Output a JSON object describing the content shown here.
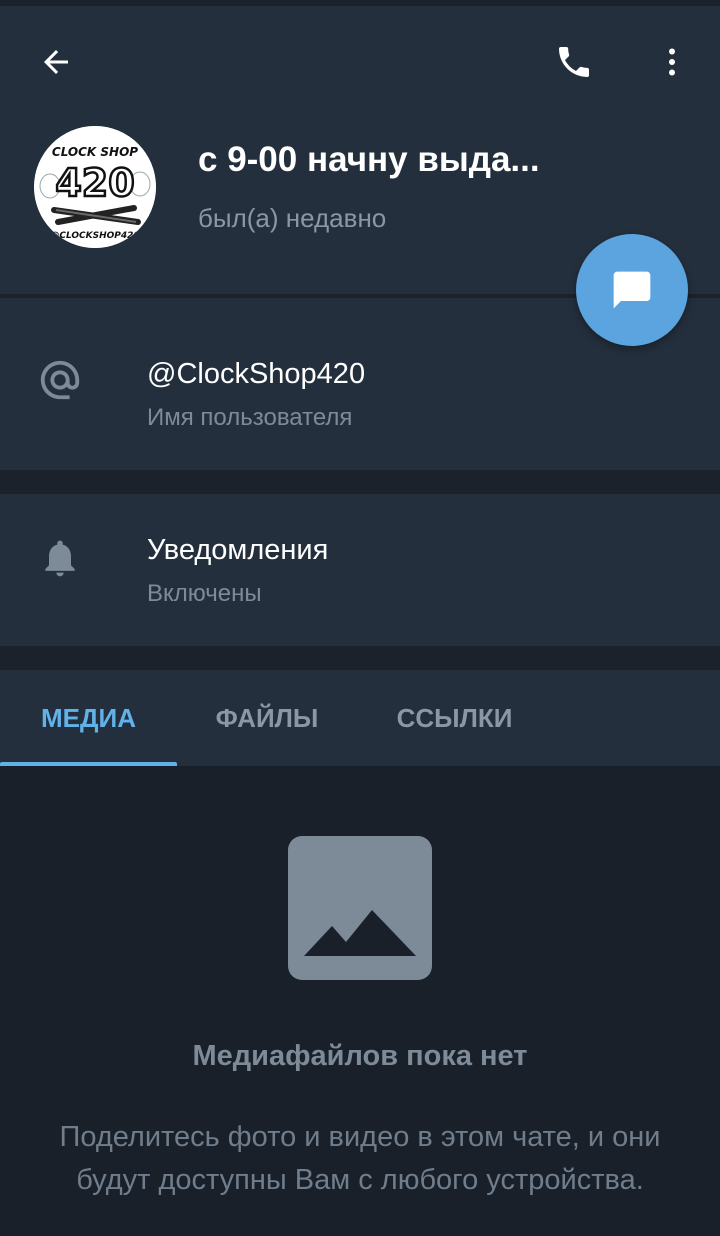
{
  "header": {
    "title": "с 9-00 начну выда...",
    "status": "был(а) недавно",
    "avatar": {
      "text_top": "CLOCK SHOP",
      "text_mid": "420",
      "text_bottom": "@CLOCKSHOP420"
    }
  },
  "info": {
    "username": "@ClockShop420",
    "username_label": "Имя пользователя",
    "notifications": "Уведомления",
    "notifications_status": "Включены"
  },
  "tabs": [
    {
      "label": "МЕДИА",
      "active": true
    },
    {
      "label": "ФАЙЛЫ",
      "active": false
    },
    {
      "label": "ССЫЛКИ",
      "active": false
    }
  ],
  "empty_state": {
    "title": "Медиафайлов пока нет",
    "text": "Поделитесь фото и видео в этом чате, и они будут доступны Вам с любого устройства."
  },
  "icons": {
    "back": "arrow-left-icon",
    "call": "phone-icon",
    "more": "more-vertical-icon",
    "message": "message-icon",
    "at": "at-sign-icon",
    "notifications": "bell-icon",
    "media": "image-icon"
  },
  "colors": {
    "header_bg": "#242f3d",
    "page_bg": "#1a2029",
    "accent": "#62b2ea",
    "fab": "#5ca4e0",
    "secondary_text": "#8a97a6"
  }
}
